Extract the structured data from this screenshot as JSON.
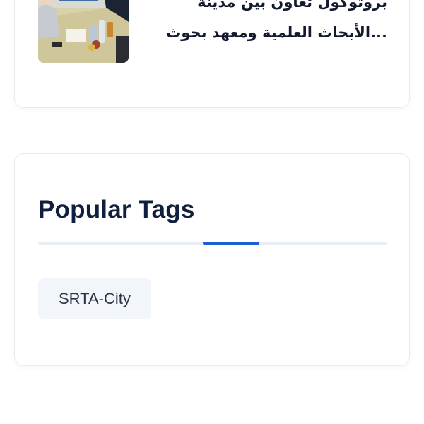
{
  "recent_post": {
    "title_line1": "بروتوكول تعاون بين مدينة",
    "title_line2": "...الأبحاث العلمية ومعهد بحوث"
  },
  "tags_widget": {
    "title": "Popular Tags",
    "tags": [
      {
        "label": "SRTA-City"
      }
    ]
  },
  "colors": {
    "accent": "#1a5fd6",
    "heading": "#0f1f3d",
    "tag_bg": "#f2f5f9",
    "divider": "#e9eef5"
  }
}
